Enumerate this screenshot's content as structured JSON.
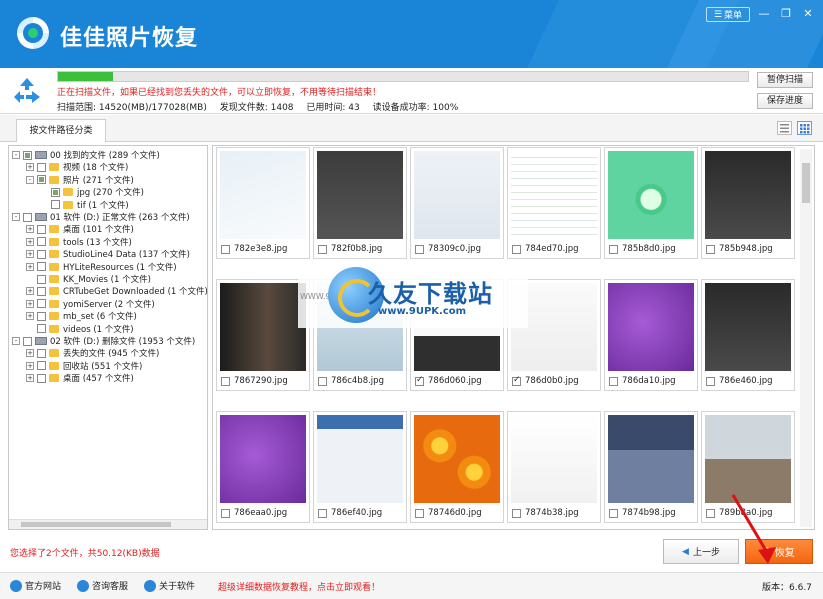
{
  "app": {
    "title": "佳佳照片恢复",
    "menu_label": "菜单"
  },
  "status": {
    "progress_percent": 8,
    "message": "正在扫描文件，如果已经找到您丢失的文件，可以立即恢复，不用等待扫描结束！",
    "scan_range": "扫描范围: 14520(MB)/177028(MB)",
    "found_count": "发现文件数: 1408",
    "elapsed": "已用时间: 43",
    "read_rate": "读设备成功率: 100%",
    "pause_label": "暂停扫描",
    "save_label": "保存进度"
  },
  "tab_label": "按文件路径分类",
  "tree": [
    {
      "text": "00 找到的文件  (289 个文件)",
      "level": 0,
      "kind": "drive",
      "check": "partial",
      "exp": "-"
    },
    {
      "text": "视频   (18 个文件)",
      "level": 1,
      "kind": "folder",
      "check": "none",
      "exp": "+"
    },
    {
      "text": "照片   (271 个文件)",
      "level": 1,
      "kind": "folder",
      "check": "partial",
      "exp": "-"
    },
    {
      "text": "jpg   (270 个文件)",
      "level": 2,
      "kind": "folder",
      "check": "partial",
      "exp": ""
    },
    {
      "text": "tif   (1 个文件)",
      "level": 2,
      "kind": "folder",
      "check": "none",
      "exp": ""
    },
    {
      "text": "01 软件 (D:) 正常文件  (263 个文件)",
      "level": 0,
      "kind": "drive",
      "check": "none",
      "exp": "-"
    },
    {
      "text": "桌面   (101 个文件)",
      "level": 1,
      "kind": "folder",
      "check": "none",
      "exp": "+"
    },
    {
      "text": "tools   (13 个文件)",
      "level": 1,
      "kind": "folder",
      "check": "none",
      "exp": "+"
    },
    {
      "text": "StudioLine4 Data   (137 个文件)",
      "level": 1,
      "kind": "folder",
      "check": "none",
      "exp": "+"
    },
    {
      "text": "HYLiteResources   (1 个文件)",
      "level": 1,
      "kind": "folder",
      "check": "none",
      "exp": "+"
    },
    {
      "text": "KK_Movies   (1 个文件)",
      "level": 1,
      "kind": "folder",
      "check": "none",
      "exp": ""
    },
    {
      "text": "CRTubeGet Downloaded   (1 个文件)",
      "level": 1,
      "kind": "folder",
      "check": "none",
      "exp": "+"
    },
    {
      "text": "yomiServer   (2 个文件)",
      "level": 1,
      "kind": "folder",
      "check": "none",
      "exp": "+"
    },
    {
      "text": "mb_set   (6 个文件)",
      "level": 1,
      "kind": "folder",
      "check": "none",
      "exp": "+"
    },
    {
      "text": "videos   (1 个文件)",
      "level": 1,
      "kind": "folder",
      "check": "none",
      "exp": ""
    },
    {
      "text": "02 软件 (D:) 删除文件  (1953 个文件)",
      "level": 0,
      "kind": "drive",
      "check": "none",
      "exp": "-"
    },
    {
      "text": "丢失的文件   (945 个文件)",
      "level": 1,
      "kind": "folder",
      "check": "none",
      "exp": "+"
    },
    {
      "text": "回收站   (551 个文件)",
      "level": 1,
      "kind": "folder",
      "check": "none",
      "exp": "+"
    },
    {
      "text": "桌面   (457 个文件)",
      "level": 1,
      "kind": "folder",
      "check": "none",
      "exp": "+"
    }
  ],
  "thumbnails": [
    {
      "name": "782e3e8.jpg",
      "checked": false,
      "style": "light"
    },
    {
      "name": "782f0b8.jpg",
      "checked": false,
      "style": "dark-ui"
    },
    {
      "name": "78309c0.jpg",
      "checked": false,
      "style": "dialog-red"
    },
    {
      "name": "784ed70.jpg",
      "checked": false,
      "style": "spreadsheet"
    },
    {
      "name": "785b8d0.jpg",
      "checked": false,
      "style": "green-circle"
    },
    {
      "name": "785b948.jpg",
      "checked": false,
      "style": "ring"
    },
    {
      "name": "7867290.jpg",
      "checked": false,
      "style": "athlete"
    },
    {
      "name": "786c4b8.jpg",
      "checked": false,
      "style": "photo-wall"
    },
    {
      "name": "786d060.jpg",
      "checked": true,
      "style": "portrait"
    },
    {
      "name": "786d0b0.jpg",
      "checked": true,
      "style": "doc-red"
    },
    {
      "name": "786da10.jpg",
      "checked": false,
      "style": "purple"
    },
    {
      "name": "786e460.jpg",
      "checked": false,
      "style": "ring"
    },
    {
      "name": "786eaa0.jpg",
      "checked": false,
      "style": "purple"
    },
    {
      "name": "786ef40.jpg",
      "checked": false,
      "style": "installer"
    },
    {
      "name": "78746d0.jpg",
      "checked": false,
      "style": "flowers"
    },
    {
      "name": "7874b38.jpg",
      "checked": false,
      "style": "web"
    },
    {
      "name": "7874b98.jpg",
      "checked": false,
      "style": "group"
    },
    {
      "name": "789b8a0.jpg",
      "checked": false,
      "style": "street"
    }
  ],
  "watermark": {
    "text": "久友下载站",
    "url": "www.9UPK.com",
    "www": "WWW.9UPK.COM"
  },
  "bottom": {
    "selection_info": "您选择了2个文件，共50.12(KB)数据",
    "prev_label": "上一步",
    "recover_label": "恢复"
  },
  "footer": {
    "site": "官方网站",
    "support": "咨询客服",
    "about": "关于软件",
    "promo": "超级详细数据恢复教程，点击立即观看！",
    "version": "版本：6.6.7"
  }
}
